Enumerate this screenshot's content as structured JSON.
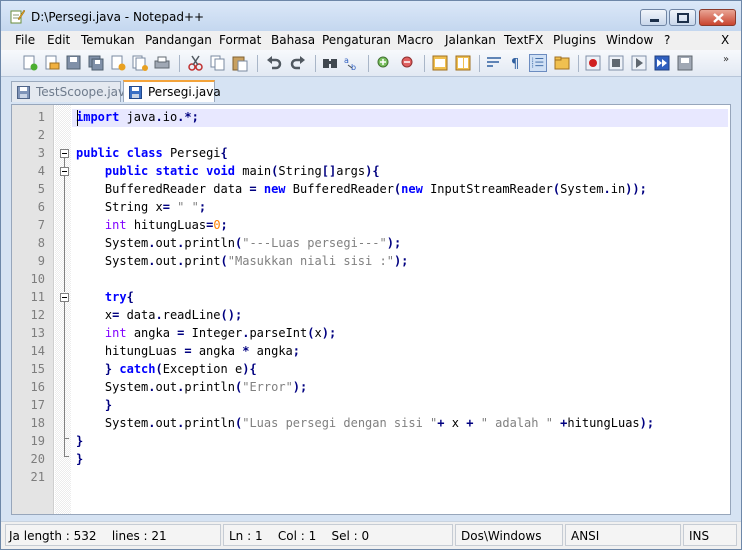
{
  "window": {
    "title": "D:\\Persegi.java - Notepad++"
  },
  "menu": [
    "File",
    "Edit",
    "Temukan",
    "Pandangan",
    "Format",
    "Bahasa",
    "Pengaturan",
    "Macro",
    "Jalankan",
    "TextFX",
    "Plugins",
    "Window",
    "?"
  ],
  "menu_close": "X",
  "toolbar": {
    "icons": [
      "new-file-icon",
      "open-file-icon",
      "save-icon",
      "save-all-icon",
      "close-icon",
      "close-all-icon",
      "print-icon",
      "cut-icon",
      "copy-icon",
      "paste-icon",
      "undo-icon",
      "redo-icon",
      "find-icon",
      "replace-icon",
      "zoom-in-icon",
      "zoom-out-icon",
      "sync-vertical-icon",
      "sync-horizontal-icon",
      "word-wrap-icon",
      "show-all-chars-icon",
      "indent-guide-icon",
      "folder-icon",
      "record-macro-icon",
      "stop-macro-icon",
      "play-macro-icon",
      "run-macro-multiple-icon",
      "save-macro-icon"
    ],
    "more": "»"
  },
  "tabs": [
    {
      "label": "TestScoope.java",
      "active": false
    },
    {
      "label": "Persegi.java",
      "active": true
    }
  ],
  "editor": {
    "line_numbers": [
      "1",
      "2",
      "3",
      "4",
      "5",
      "6",
      "7",
      "8",
      "9",
      "10",
      "11",
      "12",
      "13",
      "14",
      "15",
      "16",
      "17",
      "18",
      "19",
      "20",
      "21"
    ],
    "lines": [
      "import java.io.*;",
      "",
      "public class Persegi{",
      "    public static void main(String[]args){",
      "    BufferedReader data = new BufferedReader(new InputStreamReader(System.in));",
      "    String x= \" \";",
      "    int hitungLuas=0;",
      "    System.out.println(\"---Luas persegi---\");",
      "    System.out.print(\"Masukkan niali sisi :\");",
      "",
      "    try{",
      "    x= data.readLine();",
      "    int angka = Integer.parseInt(x);",
      "    hitungLuas = angka * angka;",
      "    } catch(Exception e){",
      "    System.out.println(\"Error\");",
      "    }",
      "    System.out.println(\"Luas persegi dengan sisi \"+ x + \" adalah \" +hitungLuas);",
      "}",
      "}",
      ""
    ]
  },
  "status": {
    "length": "length : 532",
    "lines": "lines : 21",
    "lang": "Ja",
    "ln": "Ln : 1",
    "col": "Col : 1",
    "sel": "Sel : 0",
    "eol": "Dos\\Windows",
    "encoding": "ANSI",
    "mode": "INS"
  },
  "colors": {
    "keyword": "#0000ff",
    "type": "#8000ff",
    "string": "#808080",
    "number": "#ff8000",
    "current_line": "#e8e8ff",
    "active_tab_accent": "#f3a33a"
  }
}
